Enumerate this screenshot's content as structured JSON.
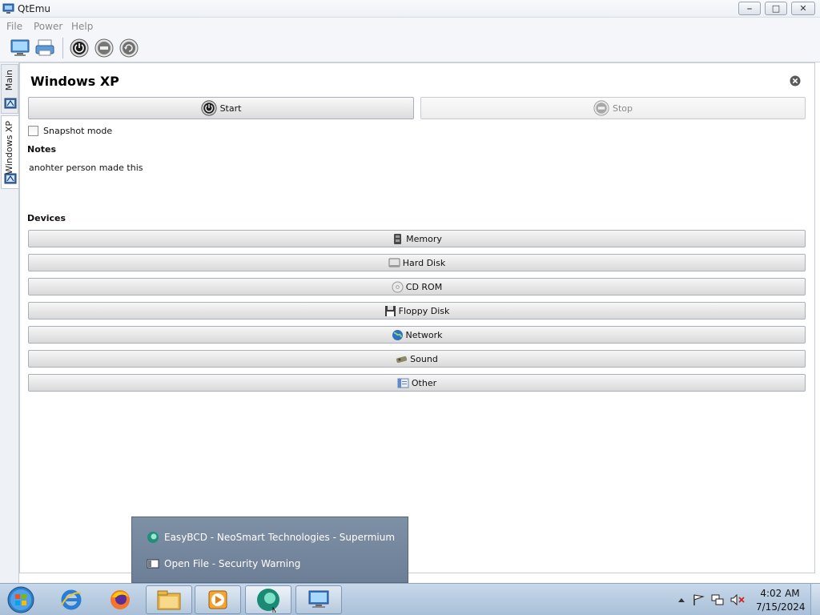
{
  "window": {
    "title": "QtEmu",
    "minimize_icon": "minimize-icon",
    "maximize_icon": "maximize-icon",
    "close_icon": "close-icon"
  },
  "menu": {
    "items": [
      "File",
      "Power",
      "Help"
    ]
  },
  "toolbar": {
    "buttons": [
      "new-machine-icon",
      "open-machine-icon",
      "power-start-icon",
      "power-stop-icon",
      "power-restart-icon"
    ]
  },
  "tabs": [
    {
      "label": "Main",
      "icon": "machine-tab-icon"
    },
    {
      "label": "Windows XP",
      "icon": "machine-tab-icon"
    }
  ],
  "vm": {
    "title": "Windows XP",
    "start_label": "Start",
    "stop_label": "Stop",
    "snapshot_label": "Snapshot mode",
    "snapshot_checked": false,
    "notes_heading": "Notes",
    "notes_text": "anohter person made this",
    "devices_heading": "Devices",
    "devices": [
      {
        "label": "Memory",
        "icon": "memory-icon"
      },
      {
        "label": "Hard Disk",
        "icon": "hard-disk-icon"
      },
      {
        "label": "CD ROM",
        "icon": "cd-rom-icon"
      },
      {
        "label": "Floppy Disk",
        "icon": "floppy-disk-icon"
      },
      {
        "label": "Network",
        "icon": "network-icon"
      },
      {
        "label": "Sound",
        "icon": "sound-icon"
      },
      {
        "label": "Other",
        "icon": "other-icon"
      }
    ]
  },
  "taskbar_popup": {
    "items": [
      {
        "label": "EasyBCD - NeoSmart Technologies - Supermium",
        "icon": "supermium-icon"
      },
      {
        "label": "Open File - Security Warning",
        "icon": "window-icon"
      }
    ]
  },
  "taskbar": {
    "items": [
      "start-orb",
      "internet-explorer-icon",
      "firefox-icon",
      "file-explorer-icon",
      "media-player-icon",
      "supermium-icon",
      "qtemu-icon"
    ],
    "clock_time": "4:02 AM",
    "clock_date": "7/15/2024"
  },
  "colors": {
    "taskbar": "#b8cde2",
    "popup": "#7589a0",
    "button_face": "#e6e6e6"
  }
}
